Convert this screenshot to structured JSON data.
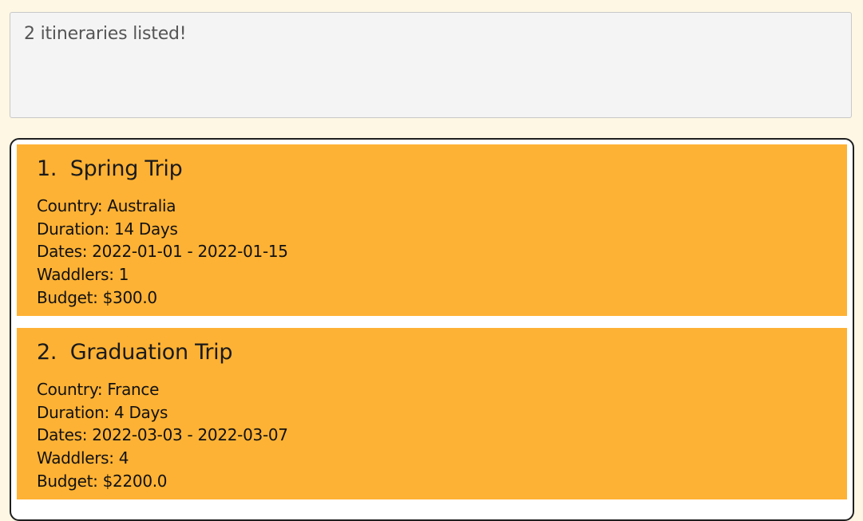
{
  "result_display": {
    "message": "2 itineraries listed!"
  },
  "itineraries": [
    {
      "title": "1.  Spring Trip",
      "country": "Country: Australia",
      "duration": "Duration: 14 Days",
      "dates": "Dates: 2022-01-01 - 2022-01-15",
      "waddlers": "Waddlers: 1",
      "budget": "Budget: $300.0"
    },
    {
      "title": "2.  Graduation Trip",
      "country": "Country: France",
      "duration": "Duration: 4 Days",
      "dates": "Dates: 2022-03-03 - 2022-03-07",
      "waddlers": "Waddlers: 4",
      "budget": "Budget: $2200.0"
    }
  ],
  "colors": {
    "background": "#fdf7e4",
    "card": "#feb235",
    "result_box": "#f4f4f4"
  }
}
